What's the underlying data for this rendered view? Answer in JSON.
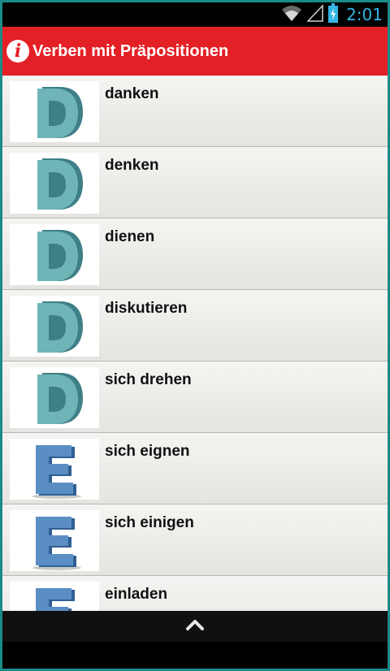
{
  "status_bar": {
    "time": "2:01",
    "icons": [
      "wifi-icon",
      "signal-icon",
      "battery-charging-icon"
    ]
  },
  "action_bar": {
    "title": "Verben mit Präpositionen",
    "icon": "info-icon",
    "color": "#e32025"
  },
  "list": {
    "items": [
      {
        "label": "danken",
        "letter": "D"
      },
      {
        "label": "denken",
        "letter": "D"
      },
      {
        "label": "dienen",
        "letter": "D"
      },
      {
        "label": "diskutieren",
        "letter": "D"
      },
      {
        "label": "sich drehen",
        "letter": "D"
      },
      {
        "label": "sich eignen",
        "letter": "E"
      },
      {
        "label": "sich einigen",
        "letter": "E"
      },
      {
        "label": "einladen",
        "letter": "E"
      }
    ]
  },
  "bottom_bar": {
    "icon": "chevron-up-icon"
  },
  "colors": {
    "letter_d": "#6fb5b8",
    "letter_d_side": "#3f7f86",
    "letter_e": "#5b8fc4",
    "letter_e_side": "#2f5f93"
  }
}
